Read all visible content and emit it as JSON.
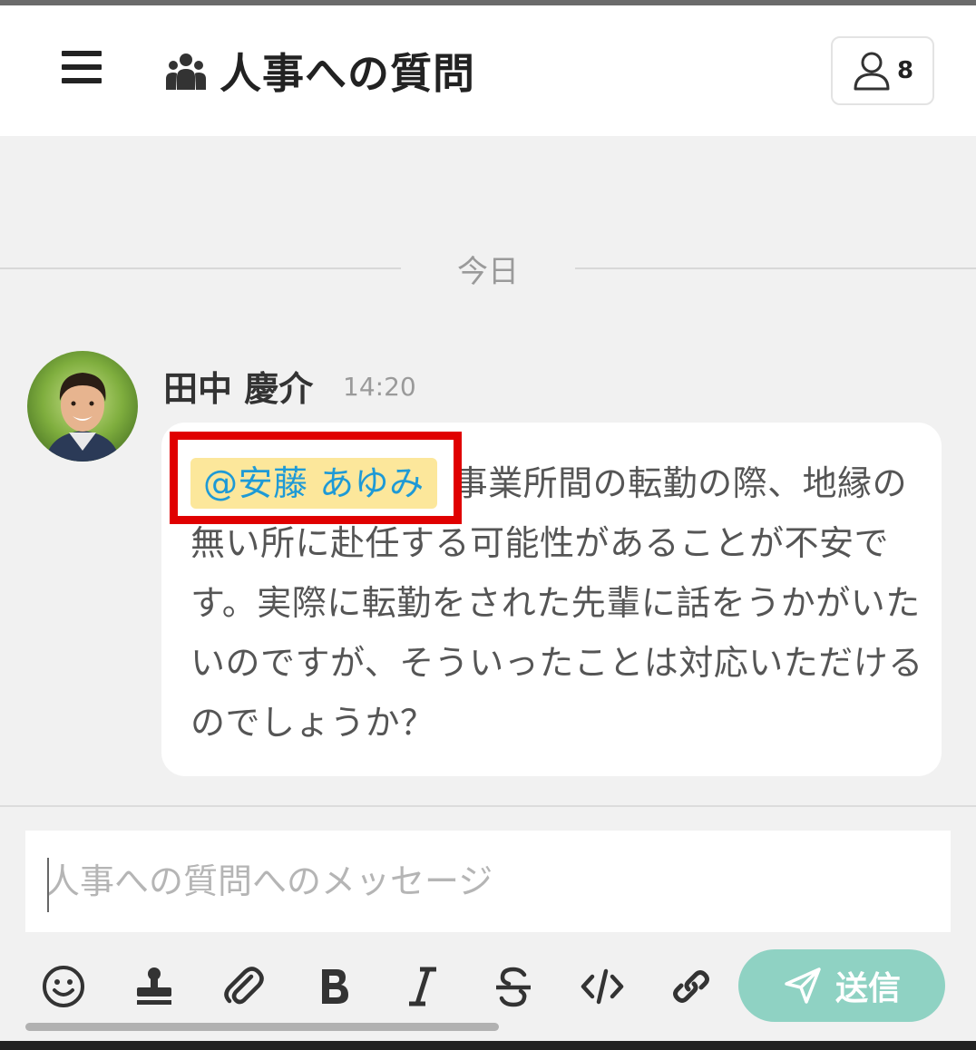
{
  "header": {
    "channel_title": "人事への質問",
    "member_count": "8",
    "icons": [
      "menu-icon",
      "group-icon",
      "member-icon"
    ]
  },
  "divider": {
    "date_label": "今日"
  },
  "message": {
    "sender": "田中 慶介",
    "time": "14:20",
    "mention": "@安藤 あゆみ",
    "body": "事業所間の転勤の際、地縁の無い所に赴任する可能性があることが不安です。実際に転勤をされた先輩に話をうかがいたいのですが、そういったことは対応いただけるのでしょうか？"
  },
  "composer": {
    "placeholder": "人事への質問へのメッセージ",
    "toolbar_icons": [
      "emoji-icon",
      "stamp-icon",
      "attachment-icon",
      "bold-icon",
      "italic-icon",
      "strikethrough-icon",
      "code-icon",
      "link-icon"
    ],
    "send_label": "送信",
    "send_color": "#8fd2c3"
  },
  "colors": {
    "mention_bg": "#fce79b",
    "mention_text": "#1e9ad6",
    "highlight": "#e00000"
  }
}
